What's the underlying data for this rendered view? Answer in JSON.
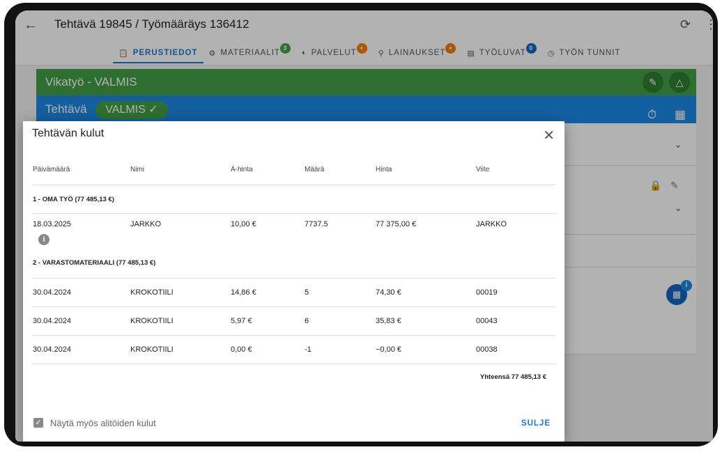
{
  "header": {
    "title": "Tehtävä 19845 / Työmääräys 136412",
    "back_icon": "arrow-left-icon",
    "refresh_icon": "refresh-icon",
    "more_icon": "more-vertical-icon"
  },
  "tabs": [
    {
      "label": "PERUSTIEDOT",
      "icon": "clipboard-icon",
      "badge": ""
    },
    {
      "label": "MATERIAALIT",
      "icon": "tool-icon",
      "badge": "3",
      "badge_color": "#43a047"
    },
    {
      "label": "PALVELUT",
      "icon": "service-icon",
      "badge": "+",
      "badge_color": "#f57c00"
    },
    {
      "label": "LAINAUKSET",
      "icon": "key-icon",
      "badge": "+",
      "badge_color": "#f57c00"
    },
    {
      "label": "TYÖLUVAT",
      "icon": "permit-icon",
      "badge": "0",
      "badge_color": "#1565c0"
    },
    {
      "label": "TYÖN TUNNIT",
      "icon": "clock-icon",
      "badge": ""
    }
  ],
  "task": {
    "type_line": "Vikatyö - VALMIS",
    "label": "Tehtävä",
    "status": "VALMIS"
  },
  "colors": {
    "green": "#43a047",
    "blue": "#1e88e5",
    "accent": "#1976d2"
  },
  "dialog": {
    "title": "Tehtävän kulut",
    "columns": [
      "Päivämäärä",
      "Nimi",
      "Á-hinta",
      "Määrä",
      "Hinta",
      "Viite"
    ],
    "groups": [
      {
        "label": "1 - OMA TYÖ (77 485,13 €)",
        "rows": [
          [
            "18.03.2025",
            "JARKKO",
            "10,00 €",
            "7737.5",
            "77 375,00 €",
            "JARKKO"
          ]
        ]
      },
      {
        "label": "2 - VARASTOMATERIAALI (77 485,13 €)",
        "rows": [
          [
            "30.04.2024",
            "KROKOTIILI",
            "14,86 €",
            "5",
            "74,30 €",
            "00019"
          ],
          [
            "30.04.2024",
            "KROKOTIILI",
            "5,97 €",
            "6",
            "35,83 €",
            "00043"
          ],
          [
            "30.04.2024",
            "KROKOTIILI",
            "0,00 €",
            "-1",
            "−0,00 €",
            "00038"
          ]
        ]
      }
    ],
    "total": "Yhteensä 77 485,13 €",
    "checkbox_label": "Näytä myös alitöiden kulut",
    "checkbox_checked": true,
    "close_label": "SULJE"
  }
}
